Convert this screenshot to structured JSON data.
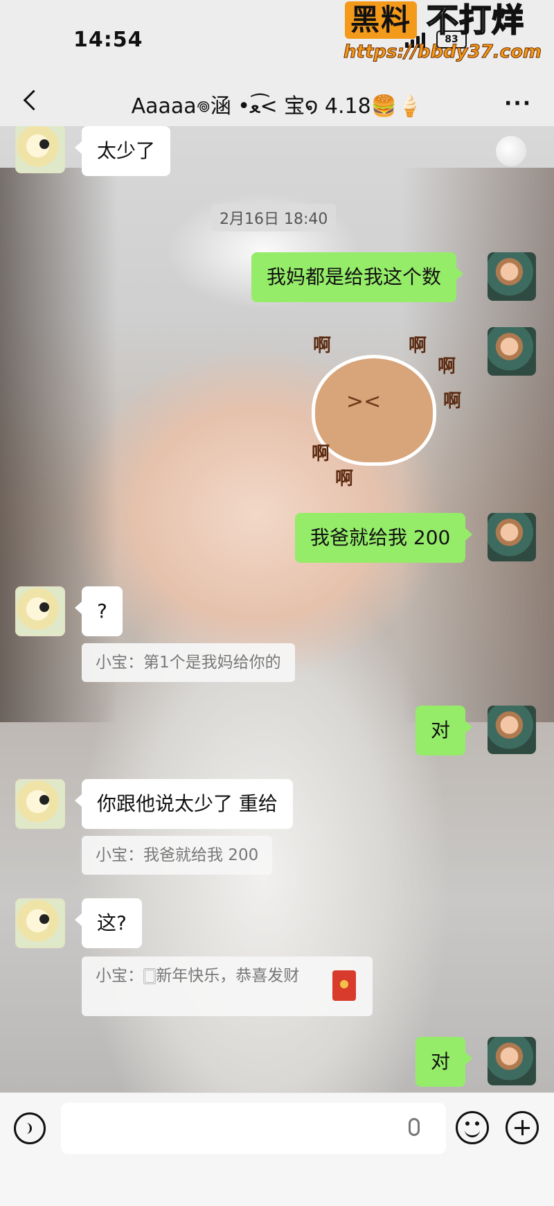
{
  "status": {
    "time": "14:54",
    "battery": "83"
  },
  "watermark": {
    "brand": "黑料",
    "tagline": "不打烊",
    "url": "https://bbdy37.com"
  },
  "header": {
    "title": "Aaaaa𖦹涵 •ﻌ<͡ 宝໑ 4.18🍔🍦"
  },
  "chat": {
    "timestamp": "2月16日 18:40",
    "messages": [
      {
        "text": "太少了"
      },
      {
        "text": "我妈都是给我这个数"
      },
      {
        "text": "我爸就给我 200"
      },
      {
        "text": "?"
      },
      {
        "text": "小宝：第1个是我妈给你的"
      },
      {
        "text": "对"
      },
      {
        "text": "你跟他说太少了 重给"
      },
      {
        "text": "小宝：我爸就给我 200"
      },
      {
        "text": "这?"
      },
      {
        "text": "小宝：🀆新年快乐，恭喜发财"
      },
      {
        "text": "对"
      }
    ],
    "sticker_text": [
      "啊",
      "啊",
      "啊",
      "啊",
      "啊",
      "啊"
    ]
  },
  "icons": {
    "voice": "voice-icon",
    "mic": "mic-icon",
    "emoji": "emoji-icon",
    "plus": "plus-icon",
    "back": "back-icon",
    "more": "more-icon"
  }
}
